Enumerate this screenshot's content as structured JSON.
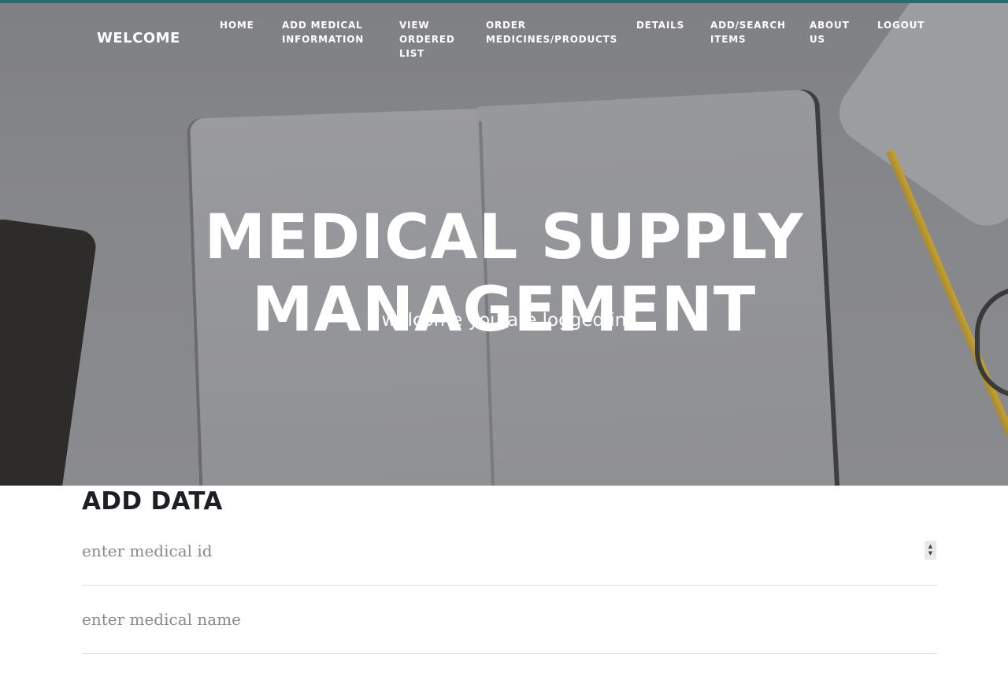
{
  "navbar": {
    "brand": "WELCOME",
    "items": [
      {
        "label": "HOME"
      },
      {
        "label": "ADD MEDICAL INFORMATION"
      },
      {
        "label": "VIEW ORDERED LIST"
      },
      {
        "label": "ORDER MEDICINES/PRODUCTS"
      },
      {
        "label": "DETAILS"
      },
      {
        "label": "ADD/SEARCH ITEMS"
      },
      {
        "label": "ABOUT US"
      },
      {
        "label": "LOGOUT"
      }
    ]
  },
  "hero": {
    "title": "MEDICAL SUPPLY MANAGEMENT",
    "subtitle": "welcome you are logged in"
  },
  "form": {
    "title": "ADD DATA",
    "medical_id_placeholder": "enter medical id",
    "medical_name_placeholder": "enter medical name"
  },
  "icons": {
    "stepper_up": "caret-up-icon",
    "stepper_down": "caret-down-icon"
  },
  "colors": {
    "accent": "#1f6f74",
    "heading": "#1e1f24"
  }
}
